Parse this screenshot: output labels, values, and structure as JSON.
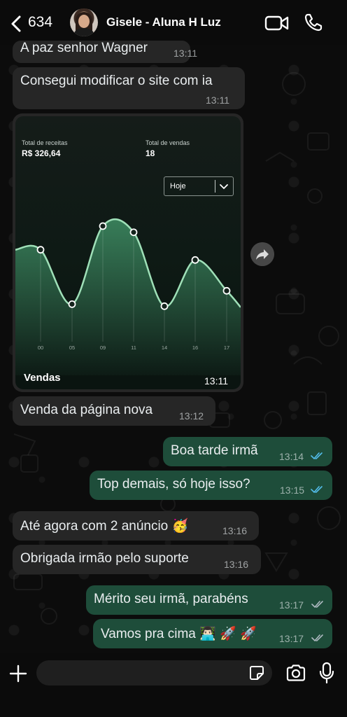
{
  "header": {
    "back_count": "634",
    "contact_name": "Gisele - Aluna H Luz"
  },
  "messages": [
    {
      "text": "A paz senhor Wagner",
      "time": "13:11",
      "dir": "in"
    },
    {
      "text": "Consegui modificar o site com ia",
      "time": "13:11",
      "dir": "in"
    },
    {
      "text": "Venda da página nova",
      "time": "13:12",
      "dir": "in"
    },
    {
      "text": "Boa tarde irmã",
      "time": "13:14",
      "dir": "out",
      "status": "read"
    },
    {
      "text": "Top demais, só hoje isso?",
      "time": "13:15",
      "dir": "out",
      "status": "read"
    },
    {
      "text": "Até agora com 2 anúncio 🥳",
      "time": "13:16",
      "dir": "in"
    },
    {
      "text": "Obrigada irmão pelo suporte",
      "time": "13:16",
      "dir": "in"
    },
    {
      "text": "Mérito seu irmã, parabéns",
      "time": "13:17",
      "dir": "out",
      "status": "delivered"
    },
    {
      "text": "Vamos pra cima 👨🏻‍💻 🚀 🚀",
      "time": "13:17",
      "dir": "out",
      "status": "delivered"
    }
  ],
  "media": {
    "caption": "Vendas",
    "time": "13:11",
    "stats": [
      {
        "label": "Total de receitas",
        "value": "R$ 326,64"
      },
      {
        "label": "Total de vendas",
        "value": "18"
      }
    ],
    "period_select": "Hoje"
  },
  "chart_data": {
    "type": "area",
    "categories": [
      "00",
      "05",
      "09",
      "11",
      "14",
      "16",
      "17"
    ],
    "values": [
      9.5,
      4.2,
      11.8,
      11.2,
      4.0,
      8.5,
      5.5
    ],
    "title": "",
    "xlabel": "",
    "ylabel": "",
    "ylim": [
      0,
      15
    ],
    "grid": false,
    "line_color": "#9fe0b8",
    "fill_color": "#3f8f65"
  },
  "input": {
    "placeholder": ""
  },
  "colors": {
    "incoming_bubble": "#262626",
    "outgoing_bubble": "#1e4d3a",
    "read_ticks": "#53bdeb",
    "delivered_ticks": "#aebac1"
  },
  "icons": [
    "back-chevron-icon",
    "video-call-icon",
    "phone-icon",
    "forward-icon",
    "plus-icon",
    "sticker-icon",
    "camera-icon",
    "mic-icon"
  ]
}
